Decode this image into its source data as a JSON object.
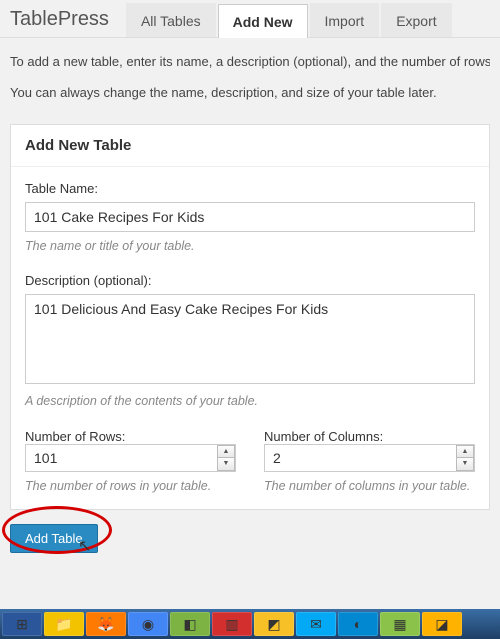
{
  "brand": "TablePress",
  "tabs": {
    "all": "All Tables",
    "add": "Add New",
    "import": "Import",
    "export": "Export"
  },
  "intro": {
    "line1": "To add a new table, enter its name, a description (optional), and the number of rows",
    "line2": "You can always change the name, description, and size of your table later."
  },
  "panel": {
    "heading": "Add New Table",
    "name_label": "Table Name:",
    "name_value": "101 Cake Recipes For Kids",
    "name_hint": "The name or title of your table.",
    "desc_label": "Description (optional):",
    "desc_value": "101 Delicious And Easy Cake Recipes For Kids",
    "desc_hint": "A description of the contents of your table.",
    "rows_label": "Number of Rows:",
    "rows_value": "101",
    "rows_hint": "The number of rows in your table.",
    "cols_label": "Number of Columns:",
    "cols_value": "2",
    "cols_hint": "The number of columns in your table."
  },
  "submit_label": "Add Table",
  "taskbar": {
    "items": [
      {
        "bg": "#2b579a",
        "glyph": "⊞"
      },
      {
        "bg": "#f3c300",
        "glyph": "📁"
      },
      {
        "bg": "#ff7a00",
        "glyph": "🦊"
      },
      {
        "bg": "#4285f4",
        "glyph": "◉"
      },
      {
        "bg": "#7cb342",
        "glyph": "◧"
      },
      {
        "bg": "#d32f2f",
        "glyph": "▥"
      },
      {
        "bg": "#f6c026",
        "glyph": "◩"
      },
      {
        "bg": "#03a9f4",
        "glyph": "✉"
      },
      {
        "bg": "#0288d1",
        "glyph": "◐"
      },
      {
        "bg": "#8bc34a",
        "glyph": "▦"
      },
      {
        "bg": "#ffb300",
        "glyph": "◪"
      }
    ]
  }
}
